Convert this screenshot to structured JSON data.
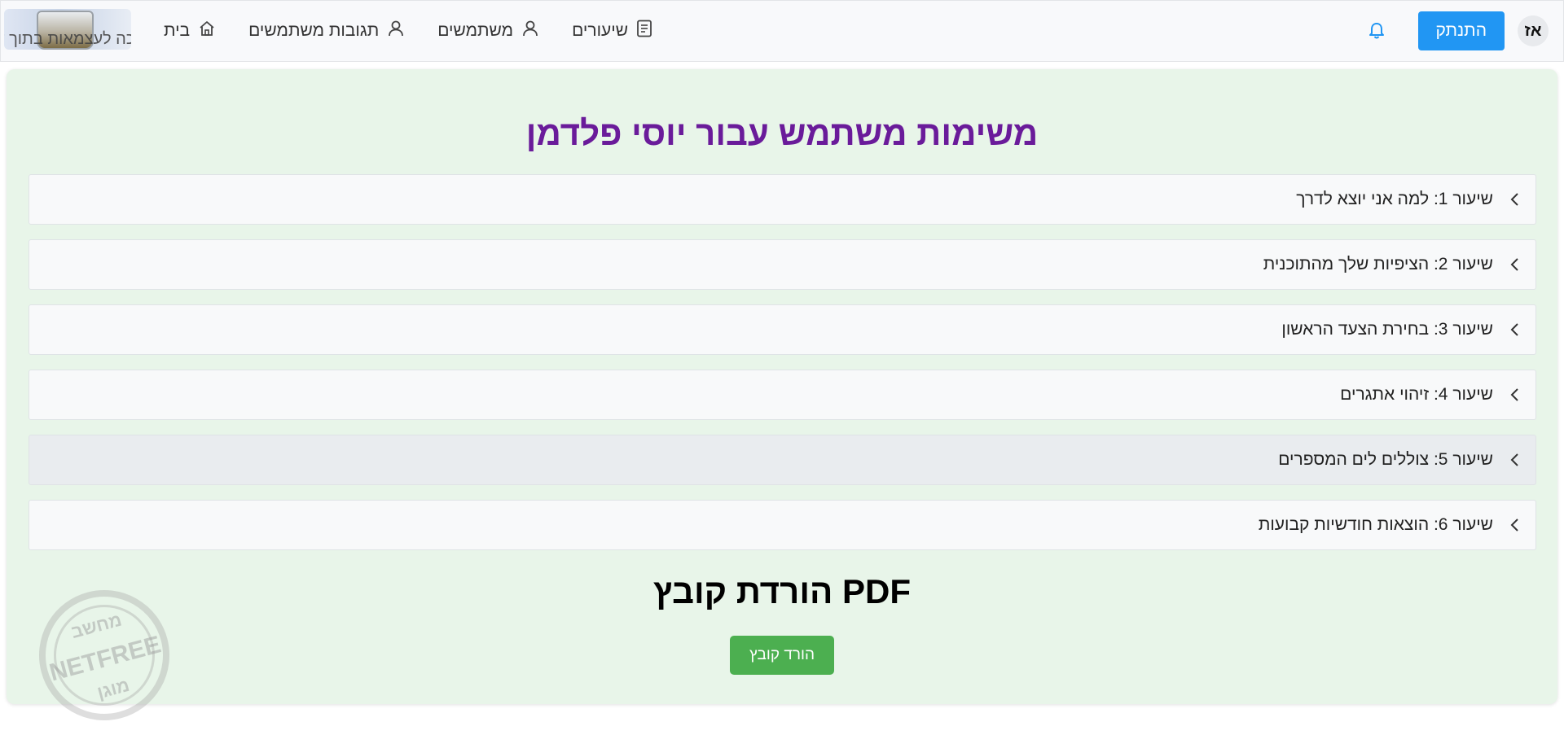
{
  "header": {
    "avatar_initials": "אז",
    "logout_label": "התנתק",
    "nav": [
      {
        "label": "שיעורים",
        "icon": "document-icon"
      },
      {
        "label": "משתמשים",
        "icon": "user-icon"
      },
      {
        "label": "תגובות משתמשים",
        "icon": "user-icon"
      },
      {
        "label": "בית",
        "icon": "home-icon"
      }
    ],
    "logo_text": "הפיכה לעצמאות בתוך דק",
    "accent_color": "#2196f3"
  },
  "main": {
    "title": "משימות משתמש עבור יוסי פלדמן",
    "title_color": "#6a1b9a",
    "lessons": [
      {
        "label": "שיעור 1: למה אני יוצא לדרך"
      },
      {
        "label": "שיעור 2: הציפיות שלך מהתוכנית"
      },
      {
        "label": "שיעור 3: בחירת הצעד הראשון"
      },
      {
        "label": "שיעור 4: זיהוי אתגרים"
      },
      {
        "label": "שיעור 5: צוללים לים המספרים"
      },
      {
        "label": "שיעור 6: הוצאות חודשיות קבועות"
      }
    ],
    "pdf_title": "PDF הורדת קובץ",
    "download_label": "הורד קובץ",
    "download_color": "#4caf50",
    "panel_color": "#e8f5e9"
  },
  "stamp": {
    "top": "מחשב",
    "middle": "NETFREE",
    "bottom": "מוגן"
  }
}
